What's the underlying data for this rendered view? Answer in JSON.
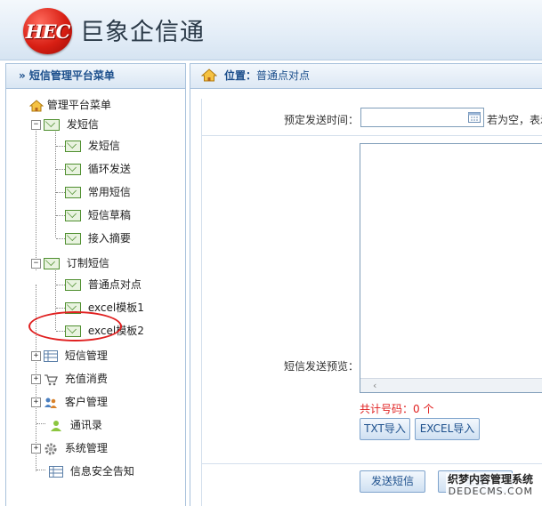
{
  "app": {
    "logo_text": "HEC",
    "title": "巨象企信通"
  },
  "sidebar": {
    "header": "» 短信管理平台菜单",
    "root": "管理平台菜单",
    "send_group": {
      "label": "发短信",
      "children": [
        "发短信",
        "循环发送",
        "常用短信",
        "短信草稿",
        "接入摘要"
      ]
    },
    "custom_group": {
      "label": "订制短信",
      "children": [
        "普通点对点",
        "excel模板1",
        "excel模板2"
      ]
    },
    "others": [
      "短信管理",
      "充值消费",
      "客户管理",
      "通讯录",
      "系统管理",
      "信息安全告知"
    ]
  },
  "breadcrumb": {
    "prefix": "位置：",
    "current": "普通点对点"
  },
  "form": {
    "schedule_label": "预定发送时间：",
    "schedule_hint": "若为空，表示",
    "preview_label": "短信发送预览：",
    "count_text": "共计号码：0 个",
    "txt_import": "TXT导入",
    "excel_import": "EXCEL导入",
    "send_button": "发送短信",
    "send_button2": "重置"
  },
  "watermark": {
    "line1": "织梦内容管理系统",
    "line2": "DEDECMS.COM"
  },
  "colors": {
    "accent": "#1c4f8c",
    "warning": "#e02020",
    "border": "#a9c2dc"
  }
}
